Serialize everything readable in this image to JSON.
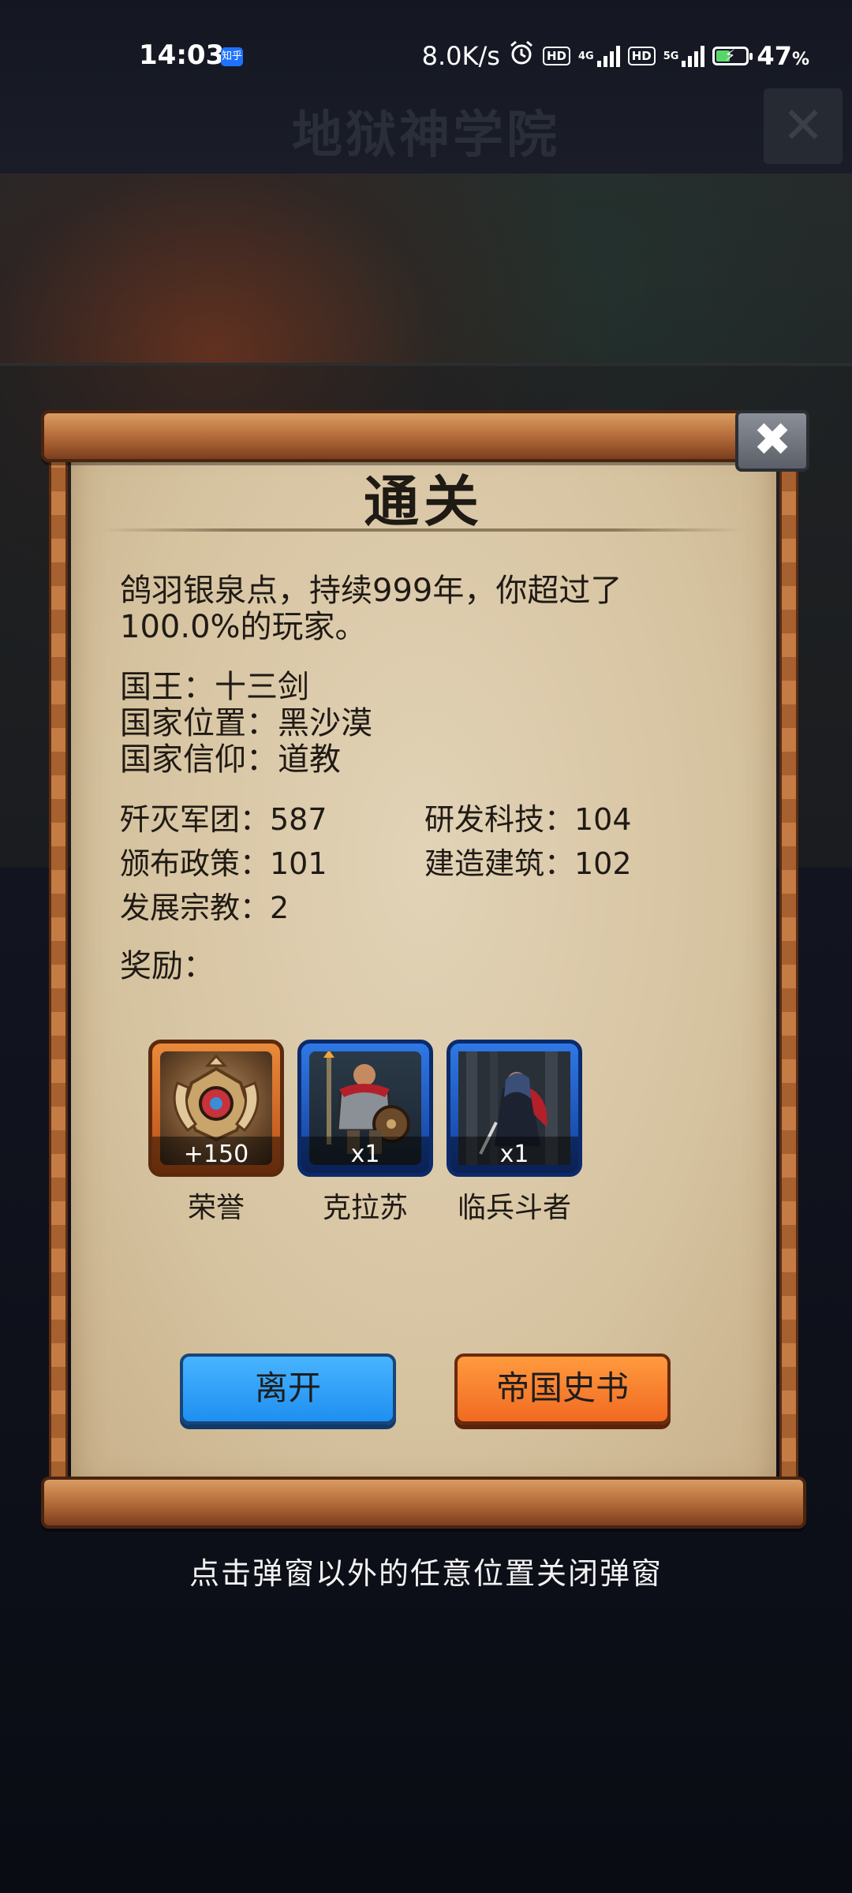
{
  "status_bar": {
    "time": "14:03",
    "app_badge": "知乎",
    "net_speed": "8.0K/s",
    "hd1": "HD",
    "net1": "4G",
    "hd2": "HD",
    "net2": "5G",
    "battery_pct": "47",
    "battery_unit": "%"
  },
  "background": {
    "title": "地狱神学院"
  },
  "dialog": {
    "title": "通关",
    "summary": "鸽羽银泉点，持续999年，你超过了100.0%的玩家。",
    "info": {
      "king": "国王：十三剑",
      "location": "国家位置：黑沙漠",
      "religion": "国家信仰：道教"
    },
    "stats": {
      "legions_destroyed": "歼灭军团：587",
      "tech_researched": "研发科技：104",
      "policies_enacted": "颁布政策：101",
      "buildings_built": "建造建筑：102",
      "religions_developed": "发展宗教：2"
    },
    "rewards_label": "奖励：",
    "rewards": [
      {
        "name": "荣誉",
        "qty": "+150",
        "icon": "honor-emblem-icon",
        "frame": "orange"
      },
      {
        "name": "克拉苏",
        "qty": "x1",
        "icon": "warrior-crassus-icon",
        "frame": "blue"
      },
      {
        "name": "临兵斗者",
        "qty": "x1",
        "icon": "cloaked-swordsman-icon",
        "frame": "blue"
      }
    ],
    "buttons": {
      "leave": "离开",
      "history": "帝国史书"
    },
    "close_glyph": "✖"
  },
  "hint": "点击弹窗以外的任意位置关闭弹窗",
  "colors": {
    "paper": "#d6c3a0",
    "wood": "#c27a45",
    "leave_button": "#1f8ff0",
    "history_button": "#f16a22"
  }
}
